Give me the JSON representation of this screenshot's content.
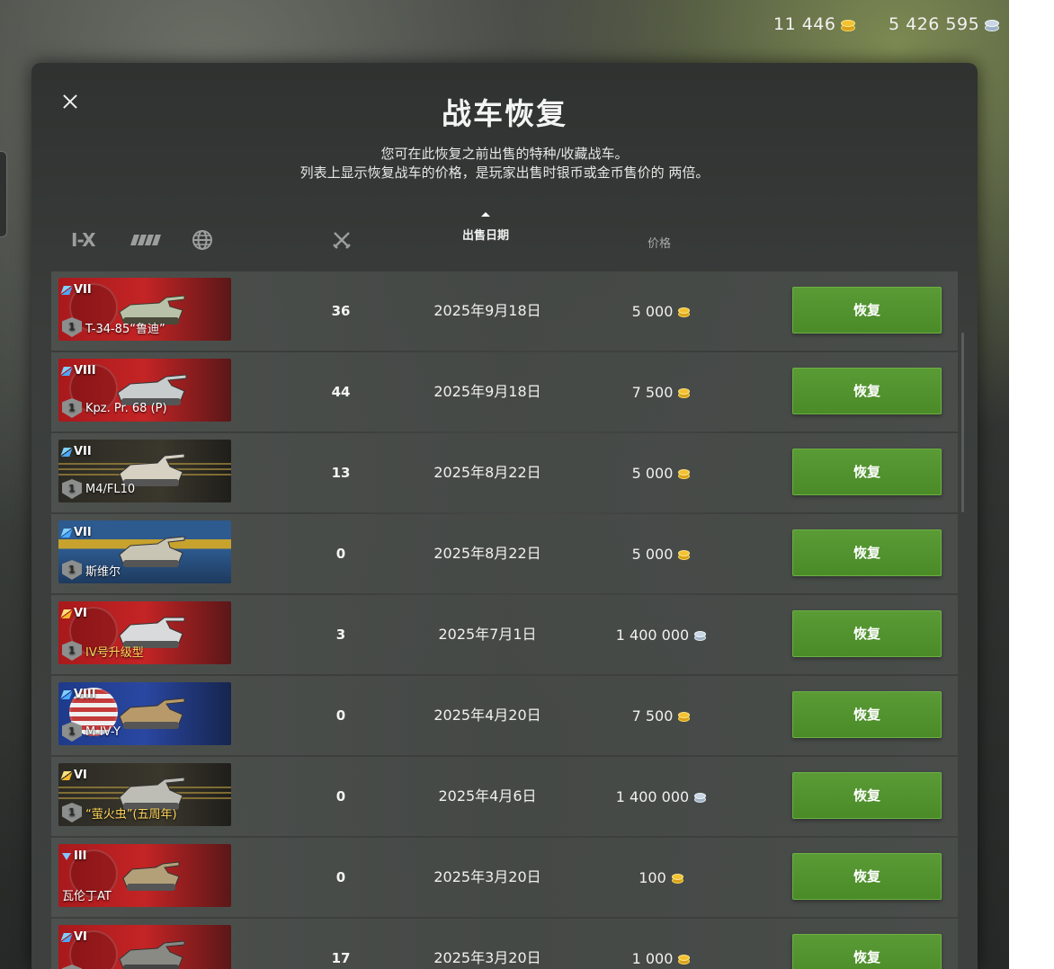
{
  "currency": {
    "gold": "11 446",
    "silver": "5 426 595"
  },
  "modal": {
    "title": "战车恢复",
    "description_line1": "您可在此恢复之前出售的特种/收藏战车。",
    "description_line2": "列表上显示恢复战车的价格，是玩家出售时银币或金币售价的 两倍。"
  },
  "filters": {
    "tier_label": "I-X",
    "nation_icon": "nation-filter-icon",
    "globe_icon": "globe-icon"
  },
  "columns": {
    "battles_icon": "crossed-swords-icon",
    "date": "出售日期",
    "price": "价格"
  },
  "vehicles": [
    {
      "tier": "VII",
      "name": "T-34-85“鲁迪”",
      "badge": "1",
      "battles": "36",
      "date": "2025年9月18日",
      "price": "5 000",
      "currency": "gold",
      "button": "恢复"
    },
    {
      "tier": "VIII",
      "name": "Kpz. Pr. 68 (P)",
      "badge": "1",
      "battles": "44",
      "date": "2025年9月18日",
      "price": "7 500",
      "currency": "gold",
      "button": "恢复"
    },
    {
      "tier": "VII",
      "name": "M4/FL10",
      "badge": "1",
      "battles": "13",
      "date": "2025年8月22日",
      "price": "5 000",
      "currency": "gold",
      "button": "恢复"
    },
    {
      "tier": "VII",
      "name": "斯维尔",
      "badge": "1",
      "battles": "0",
      "date": "2025年8月22日",
      "price": "5 000",
      "currency": "gold",
      "button": "恢复"
    },
    {
      "tier": "VI",
      "name": "IV号升级型",
      "badge": "1",
      "battles": "3",
      "date": "2025年7月1日",
      "price": "1 400 000",
      "currency": "silver",
      "button": "恢复"
    },
    {
      "tier": "VIII",
      "name": "M-IV-Y",
      "badge": "1",
      "battles": "0",
      "date": "2025年4月20日",
      "price": "7 500",
      "currency": "gold",
      "button": "恢复"
    },
    {
      "tier": "VI",
      "name": "“萤火虫”(五周年)",
      "badge": "1",
      "battles": "0",
      "date": "2025年4月6日",
      "price": "1 400 000",
      "currency": "silver",
      "button": "恢复"
    },
    {
      "tier": "III",
      "name": "瓦伦丁AT",
      "badge": "",
      "battles": "0",
      "date": "2025年3月20日",
      "price": "100",
      "currency": "gold",
      "button": "恢复"
    },
    {
      "tier": "VI",
      "name": "",
      "badge": "1",
      "battles": "17",
      "date": "2025年3月20日",
      "price": "1 000",
      "currency": "gold",
      "button": "恢复"
    }
  ]
}
